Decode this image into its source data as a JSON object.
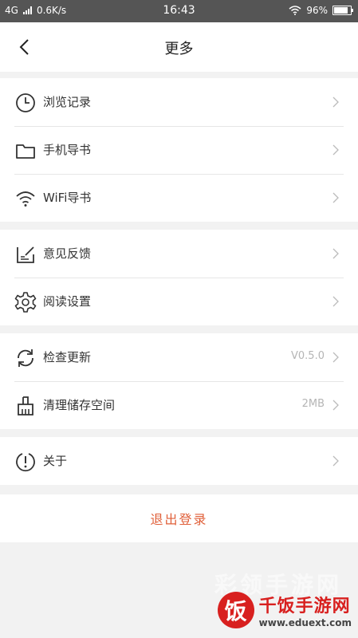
{
  "status_bar": {
    "network": "4G",
    "speed": "0.6K/s",
    "time": "16:43",
    "battery": "96%"
  },
  "header": {
    "title": "更多"
  },
  "groups": [
    {
      "items": [
        {
          "label": "浏览记录",
          "icon": "clock-icon"
        },
        {
          "label": "手机导书",
          "icon": "folder-icon"
        },
        {
          "label": "WiFi导书",
          "icon": "wifi-icon"
        }
      ]
    },
    {
      "items": [
        {
          "label": "意见反馈",
          "icon": "feedback-icon"
        },
        {
          "label": "阅读设置",
          "icon": "gear-icon"
        }
      ]
    },
    {
      "items": [
        {
          "label": "检查更新",
          "value": "V0.5.0",
          "icon": "refresh-icon"
        },
        {
          "label": "清理储存空间",
          "value": "2MB",
          "icon": "broom-icon"
        }
      ]
    },
    {
      "items": [
        {
          "label": "关于",
          "icon": "info-icon"
        }
      ]
    }
  ],
  "logout": {
    "label": "退出登录",
    "color": "#e0603a"
  },
  "watermark": {
    "top_text": "彩领手游网",
    "brand_char": "饭",
    "brand_name": "千饭手游网",
    "url": "www.eduext.com"
  }
}
